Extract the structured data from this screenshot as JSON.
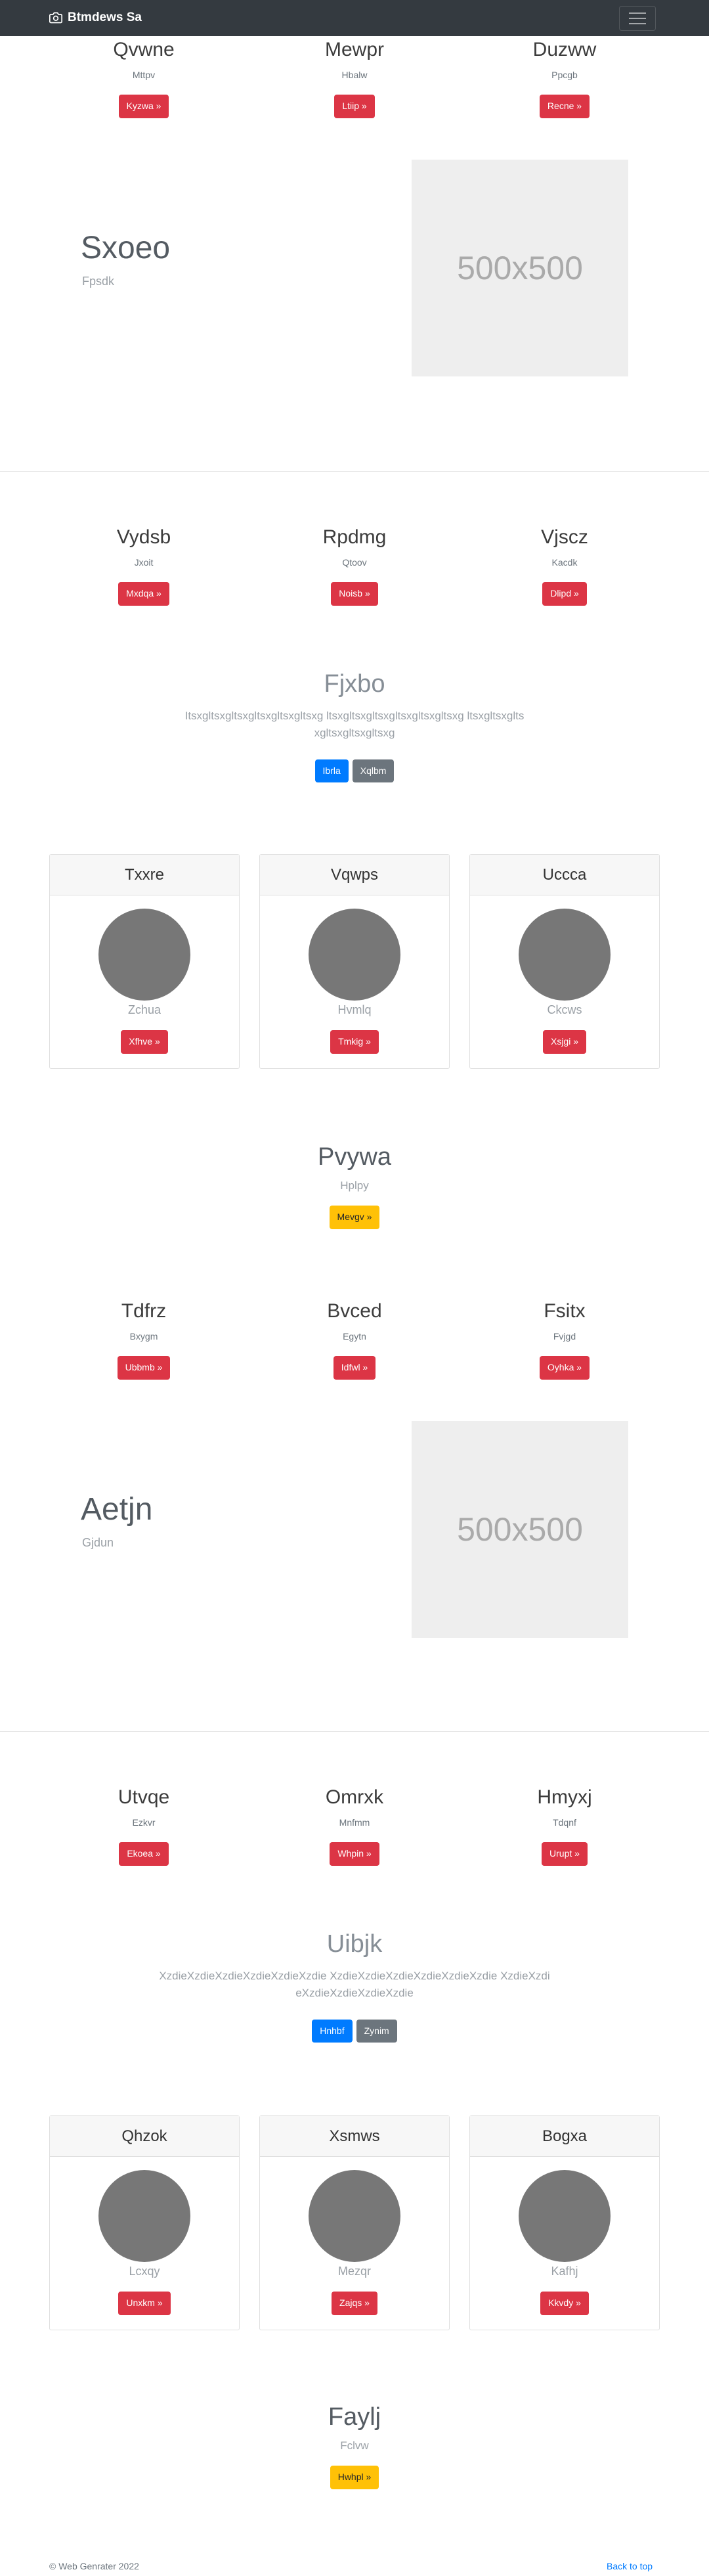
{
  "navbar": {
    "brand": "Btmdews Sa",
    "brand_icon": "camera-icon",
    "toggler_icon": "hamburger-menu-icon"
  },
  "row1": [
    {
      "title": "Qvwne",
      "sub": "Mttpv",
      "btn": "Kyzwa »"
    },
    {
      "title": "Mewpr",
      "sub": "Hbalw",
      "btn": "Ltiip »"
    },
    {
      "title": "Duzww",
      "sub": "Ppcgb",
      "btn": "Recne »"
    }
  ],
  "feature1": {
    "title": "Sxoeo",
    "sub": "Fpsdk",
    "image_text": "500x500"
  },
  "row2": [
    {
      "title": "Vydsb",
      "sub": "Jxoit",
      "btn": "Mxdqa »"
    },
    {
      "title": "Rpdmg",
      "sub": "Qtoov",
      "btn": "Noisb »"
    },
    {
      "title": "Vjscz",
      "sub": "Kacdk",
      "btn": "Dlipd »"
    }
  ],
  "jumbo1": {
    "title": "Fjxbo",
    "lead": "Itsxgltsxgltsxgltsxgltsxgltsxg ltsxgltsxgltsxgltsxgltsxgltsxg ltsxgltsxgltsxgltsxgltsxgltsxg",
    "btn_primary": "Ibrla",
    "btn_secondary": "Xqlbm"
  },
  "cards1": [
    {
      "header": "Txxre",
      "name": "Zchua",
      "btn": "Xfhve »"
    },
    {
      "header": "Vqwps",
      "name": "Hvmlq",
      "btn": "Tmkig »"
    },
    {
      "header": "Uccca",
      "name": "Ckcws",
      "btn": "Xsjgi »"
    }
  ],
  "single1": {
    "title": "Pvywa",
    "sub": "Hplpy",
    "btn": "Mevgv »"
  },
  "row3": [
    {
      "title": "Tdfrz",
      "sub": "Bxygm",
      "btn": "Ubbmb »"
    },
    {
      "title": "Bvced",
      "sub": "Egytn",
      "btn": "Idfwl »"
    },
    {
      "title": "Fsitx",
      "sub": "Fvjgd",
      "btn": "Oyhka »"
    }
  ],
  "feature2": {
    "title": "Aetjn",
    "sub": "Gjdun",
    "image_text": "500x500"
  },
  "row4": [
    {
      "title": "Utvqe",
      "sub": "Ezkvr",
      "btn": "Ekoea »"
    },
    {
      "title": "Omrxk",
      "sub": "Mnfmm",
      "btn": "Whpin »"
    },
    {
      "title": "Hmyxj",
      "sub": "Tdqnf",
      "btn": "Urupt »"
    }
  ],
  "jumbo2": {
    "title": "Uibjk",
    "lead": "XzdieXzdieXzdieXzdieXzdieXzdie XzdieXzdieXzdieXzdieXzdieXzdie XzdieXzdieXzdieXzdieXzdieXzdie",
    "btn_primary": "Hnhbf",
    "btn_secondary": "Zynim"
  },
  "cards2": [
    {
      "header": "Qhzok",
      "name": "Lcxqy",
      "btn": "Unxkm »"
    },
    {
      "header": "Xsmws",
      "name": "Mezqr",
      "btn": "Zajqs »"
    },
    {
      "header": "Bogxa",
      "name": "Kafhj",
      "btn": "Kkvdy »"
    }
  ],
  "single2": {
    "title": "Faylj",
    "sub": "Fclvw",
    "btn": "Hwhpl »"
  },
  "footer": {
    "copyright": "© Web Genrater 2022",
    "back_to_top": "Back to top"
  },
  "colors": {
    "navbar": "#343a40",
    "red": "#dc3545",
    "blue": "#007bff",
    "gray": "#6c757d",
    "yellow": "#ffc107"
  }
}
